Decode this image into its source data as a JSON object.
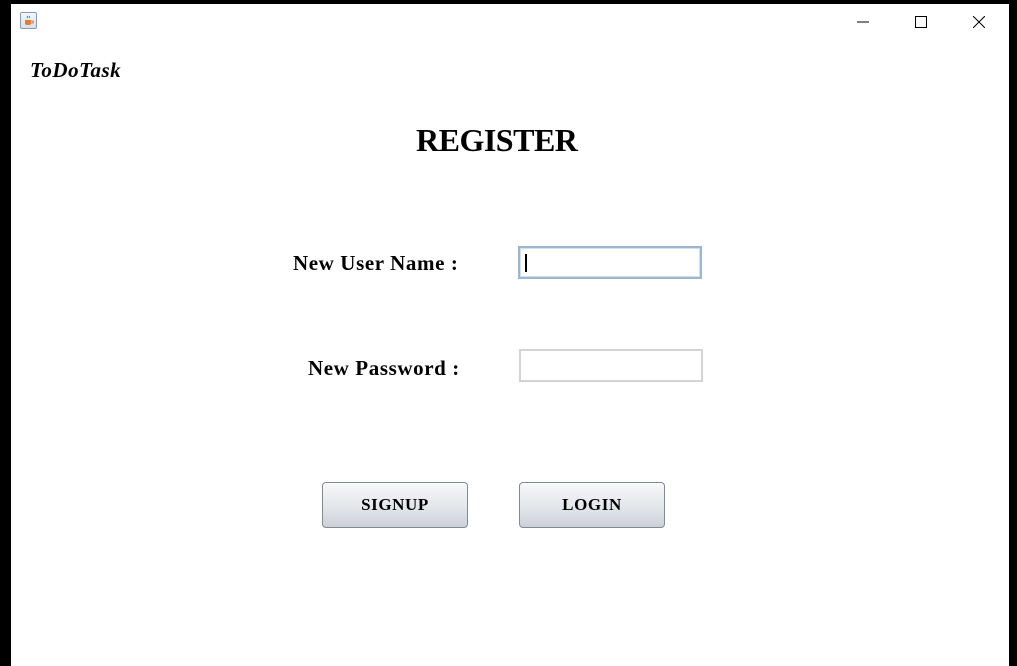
{
  "window": {
    "app_icon": "java-cup-icon",
    "controls": [
      "minimize-icon",
      "maximize-icon",
      "close-icon"
    ]
  },
  "brand": "ToDoTask",
  "form": {
    "title": "REGISTER",
    "username_label": "New User Name :",
    "username_value": "",
    "password_label": "New Password :",
    "password_value": ""
  },
  "buttons": {
    "signup": "SIGNUP",
    "login": "LOGIN"
  }
}
